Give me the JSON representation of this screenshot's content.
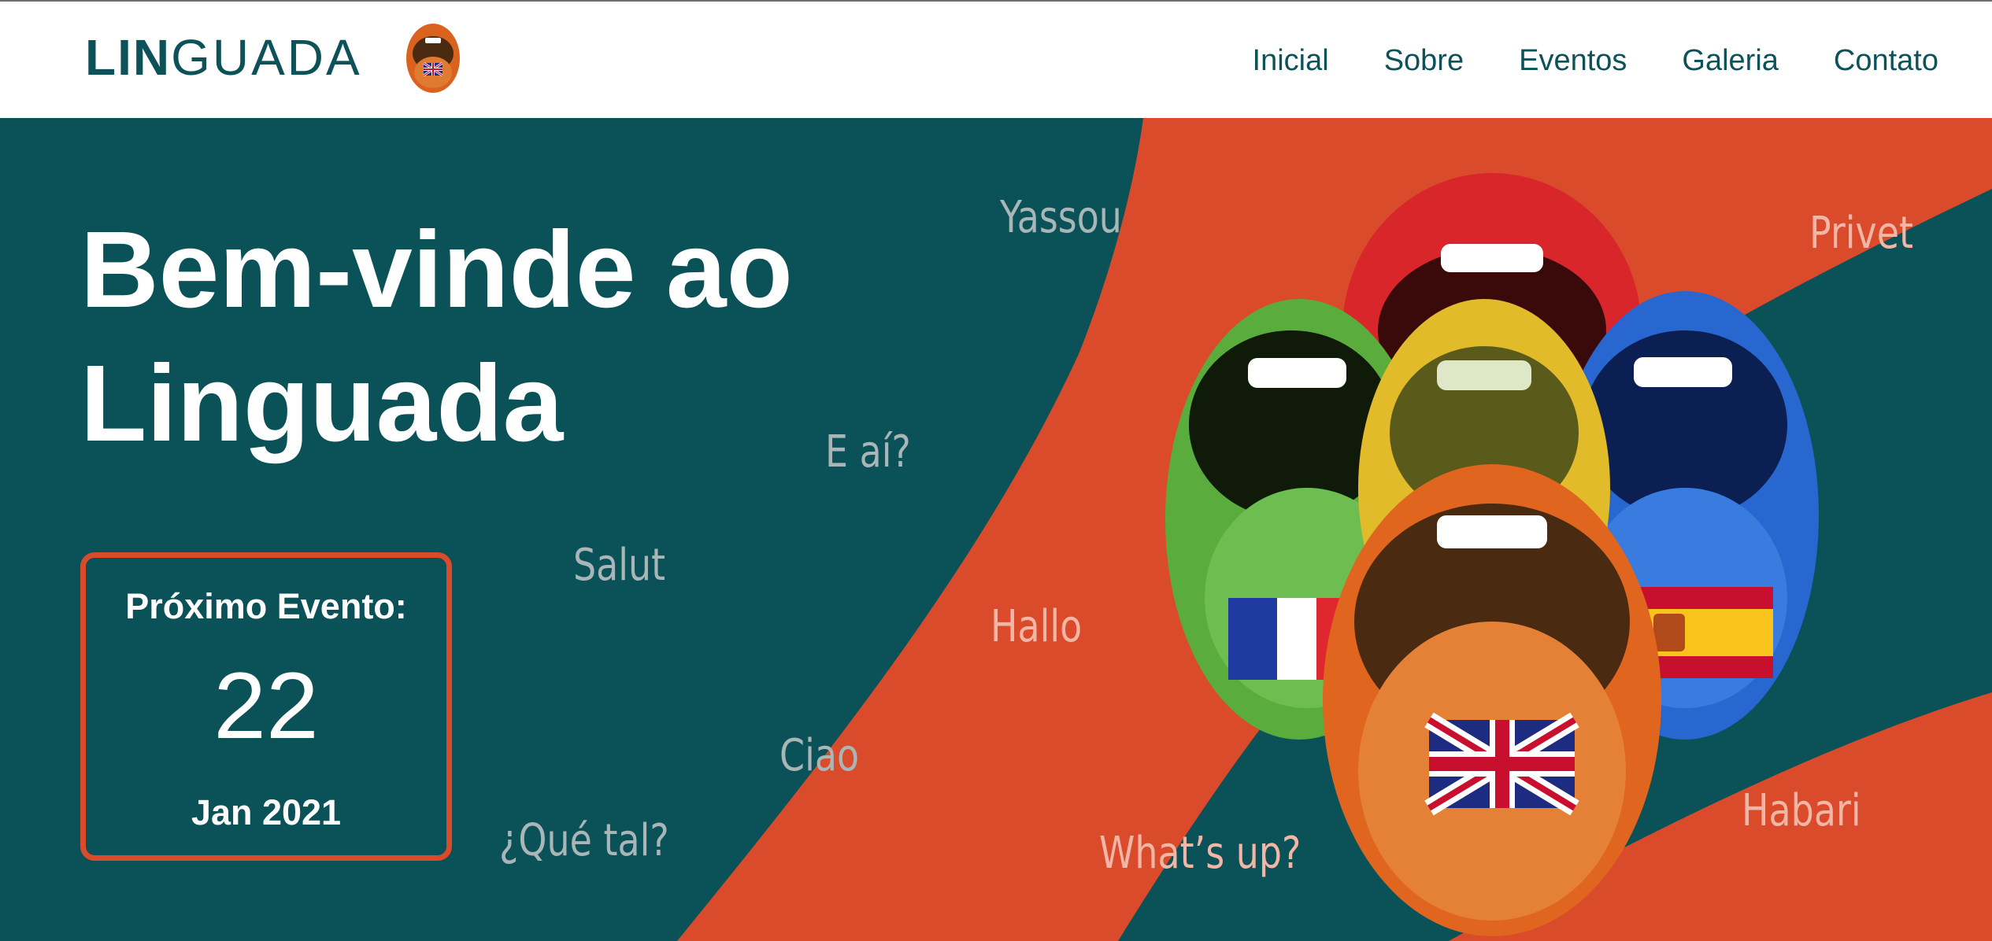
{
  "header": {
    "logo_bold": "LIN",
    "logo_light": "GUADA",
    "nav": [
      {
        "label": "Inicial"
      },
      {
        "label": "Sobre"
      },
      {
        "label": "Eventos"
      },
      {
        "label": "Galeria"
      },
      {
        "label": "Contato"
      }
    ]
  },
  "hero": {
    "title_line1": "Bem-vinde ao",
    "title_line2": "Linguada",
    "event": {
      "label": "Próximo Evento:",
      "day": "22",
      "month_year": "Jan 2021"
    },
    "greetings": {
      "yassou": "Yassou",
      "eai": "E aí?",
      "salut": "Salut",
      "hallo": "Hallo",
      "ciao": "Ciao",
      "quetal": "¿Qué tal?",
      "whatsup": "What’s up?",
      "privet": "Privet",
      "habari": "Habari"
    }
  },
  "colors": {
    "teal": "#0b5158",
    "orange": "#d94b2a",
    "nav_text": "#0c5258"
  },
  "icons": [
    "mouth-logo-icon",
    "french-flag-icon",
    "spanish-flag-icon",
    "uk-flag-icon"
  ]
}
